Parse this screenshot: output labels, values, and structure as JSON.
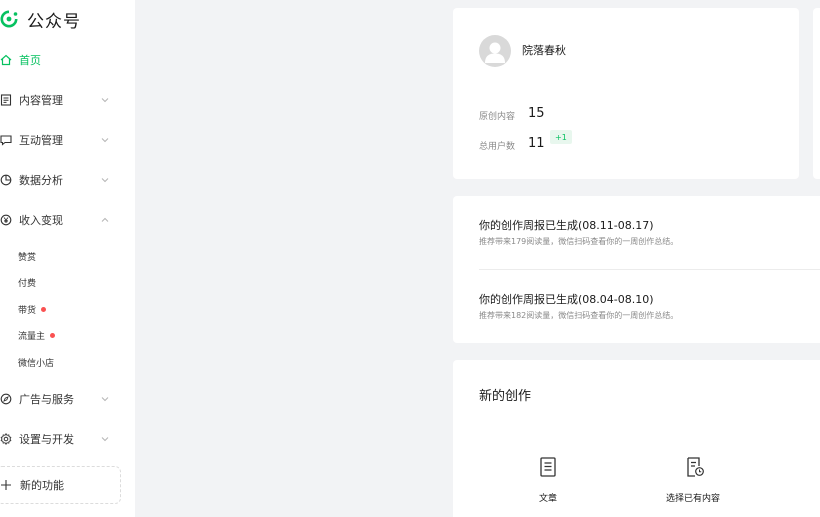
{
  "brand": {
    "name": "公众号",
    "logo_icon": "wechat-official-account-logo",
    "accent": "#07c160"
  },
  "sidebar": {
    "items": [
      {
        "label": "首页",
        "icon": "home-icon",
        "active": true
      },
      {
        "label": "内容管理",
        "icon": "document-icon"
      },
      {
        "label": "互动管理",
        "icon": "message-icon"
      },
      {
        "label": "数据分析",
        "icon": "pie-chart-icon"
      },
      {
        "label": "收入变现",
        "icon": "yen-icon",
        "expanded": true
      },
      {
        "label": "广告与服务",
        "icon": "compass-icon"
      },
      {
        "label": "设置与开发",
        "icon": "gear-icon"
      }
    ],
    "sub_items": [
      {
        "label": "赞赏"
      },
      {
        "label": "付费"
      },
      {
        "label": "带货",
        "dot": true
      },
      {
        "label": "流量主",
        "dot": true
      },
      {
        "label": "微信小店"
      }
    ],
    "new_function": "新的功能"
  },
  "account": {
    "name": "院落春秋",
    "stats": [
      {
        "label": "原创内容",
        "value": "15"
      },
      {
        "label": "总用户数",
        "value": "11"
      }
    ],
    "user_badge": "+1"
  },
  "reports": [
    {
      "title": "你的创作周报已生成(08.11-08.17)",
      "desc": "推荐带来179阅读量，微信扫码查看你的一周创作总结。"
    },
    {
      "title": "你的创作周报已生成(08.04-08.10)",
      "desc": "推荐带来182阅读量，微信扫码查看你的一周创作总结。"
    }
  ],
  "create": {
    "title": "新的创作",
    "options": [
      {
        "label": "文章",
        "icon": "article-icon"
      },
      {
        "label": "选择已有内容",
        "icon": "existing-content-icon"
      }
    ]
  }
}
